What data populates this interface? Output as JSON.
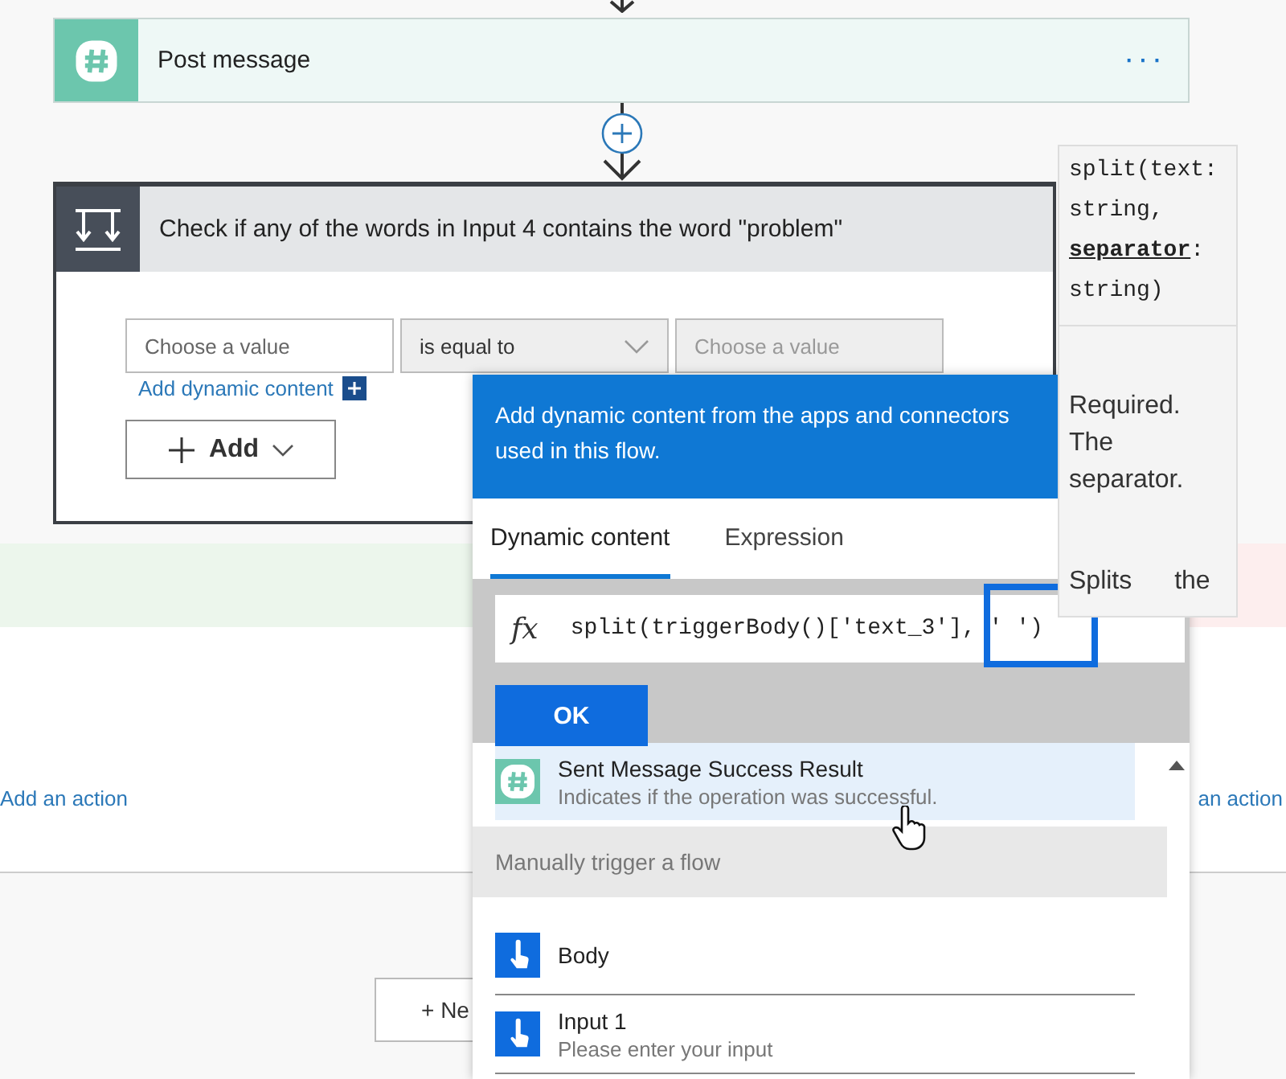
{
  "post_message": {
    "title": "Post message",
    "menu": "···"
  },
  "condition": {
    "title": "Check if any of the words in Input 4 contains the word \"problem\"",
    "left_value": {
      "placeholder": "Choose a value",
      "disabled": false
    },
    "operator": {
      "value": "is equal to",
      "disabled": true
    },
    "right_value": {
      "placeholder": "Choose a value",
      "disabled": true
    },
    "dynamic_link": "Add dynamic content",
    "add_button": "Add"
  },
  "branches": {
    "left_action": "Add an action",
    "right_action": "an action"
  },
  "new_step_button": "+ Ne",
  "popup": {
    "header": "Add dynamic content from the apps and connectors used in this flow.",
    "tabs": [
      {
        "label": "Dynamic content",
        "selected": true
      },
      {
        "label": "Expression",
        "selected": false
      }
    ],
    "expression": {
      "symbol": "fx",
      "value": "split(triggerBody()['text_3'], ' ')"
    },
    "ok_button": "OK",
    "items": [
      {
        "kind": "action_output",
        "title": "Sent Message Success Result",
        "description": "Indicates if the operation was successful.",
        "color": "#6cc6ad",
        "selected": true
      },
      {
        "kind": "group",
        "title": "Manually trigger a flow"
      },
      {
        "kind": "trigger_output",
        "title": "Body",
        "color": "#0f6cde",
        "selected": false
      },
      {
        "kind": "trigger_output",
        "title": "Input 1",
        "description": "Please enter your input",
        "color": "#0f6cde",
        "selected": false
      }
    ]
  },
  "tooltip": {
    "signature": "split(text: string, **separator**: string)",
    "parameter_help": "Required. The separator.",
    "description": "Splits the"
  }
}
